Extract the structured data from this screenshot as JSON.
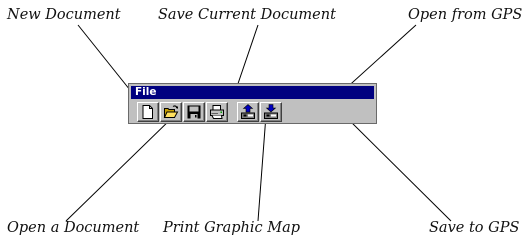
{
  "annotations": {
    "new_document": "New Document",
    "save_current_document": "Save Current Document",
    "open_from_gps": "Open from GPS",
    "open_a_document": "Open a Document",
    "print_graphic_map": "Print Graphic Map",
    "save_to_gps": "Save to GPS"
  },
  "toolbar": {
    "title": "File",
    "title_color": "#000080",
    "buttons": [
      {
        "icon": "new-document-icon"
      },
      {
        "icon": "open-folder-icon"
      },
      {
        "icon": "save-disk-icon"
      },
      {
        "icon": "printer-icon"
      },
      {
        "icon": "open-from-gps-icon"
      },
      {
        "icon": "save-to-gps-icon"
      }
    ]
  }
}
